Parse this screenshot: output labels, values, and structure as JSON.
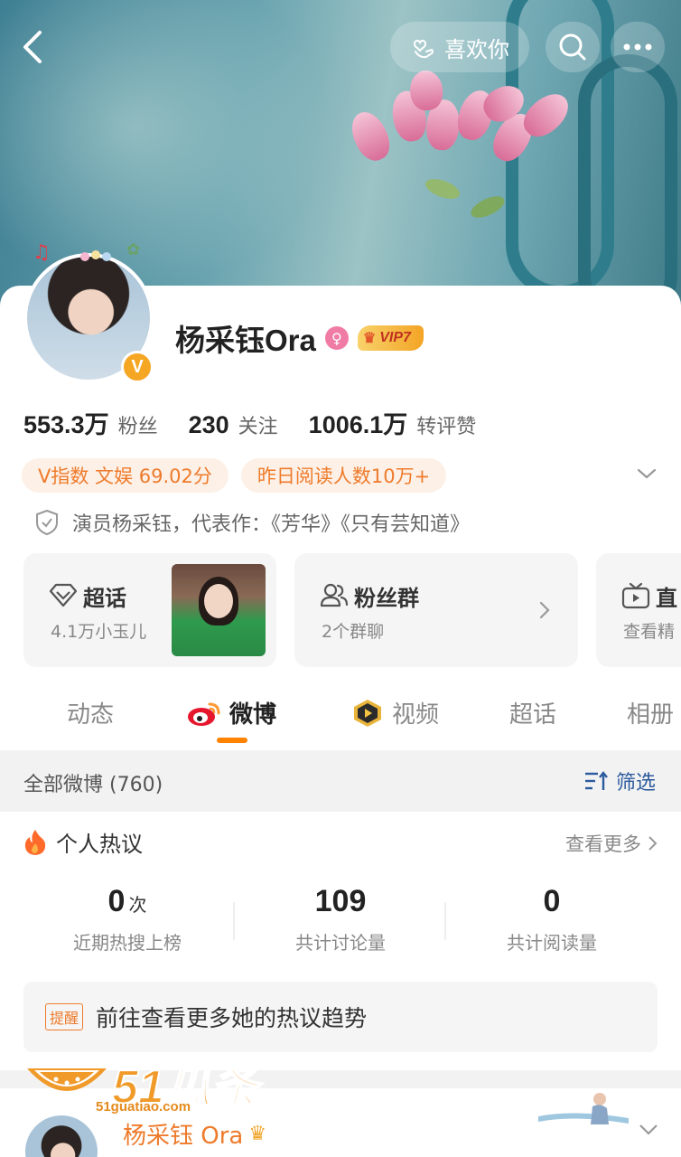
{
  "header": {
    "like_label": "喜欢你"
  },
  "profile": {
    "name": "杨采钰Ora",
    "gender_symbol": "♀",
    "vip_label": "VIP7",
    "verified_mark": "V",
    "stats": [
      {
        "value": "553.3万",
        "label": "粉丝"
      },
      {
        "value": "230",
        "label": "关注"
      },
      {
        "value": "1006.1万",
        "label": "转评赞"
      }
    ],
    "tags": [
      "V指数 文娱 69.02分",
      "昨日阅读人数10万+"
    ],
    "bio": "演员杨采钰，代表作：《芳华》《只有芸知道》"
  },
  "tiles": [
    {
      "title": "超话",
      "sub": "4.1万小玉儿"
    },
    {
      "title": "粉丝群",
      "sub": "2个群聊"
    },
    {
      "title": "直",
      "sub": "查看精"
    }
  ],
  "tabs": [
    "动态",
    "微博",
    "视频",
    "超话",
    "相册"
  ],
  "filter": {
    "count_label": "全部微博 (760)",
    "filter_label": "筛选"
  },
  "hot": {
    "title": "个人热议",
    "more_label": "查看更多",
    "metrics": [
      {
        "value": "0",
        "unit": "次",
        "label": "近期热搜上榜"
      },
      {
        "value": "109",
        "unit": "",
        "label": "共计讨论量"
      },
      {
        "value": "0",
        "unit": "",
        "label": "共计阅读量"
      }
    ],
    "reminder_badge": "提醒",
    "reminder_text": "前往查看更多她的热议趋势"
  },
  "post": {
    "author": "杨采钰 Ora"
  },
  "watermark": {
    "brand": "51瓜条",
    "url": "51guatiao.com"
  },
  "colors": {
    "accent": "#ff8200",
    "tag_text": "#ee7b2c",
    "tag_bg": "#fdf0e6",
    "link_blue": "#2c5a9e"
  }
}
